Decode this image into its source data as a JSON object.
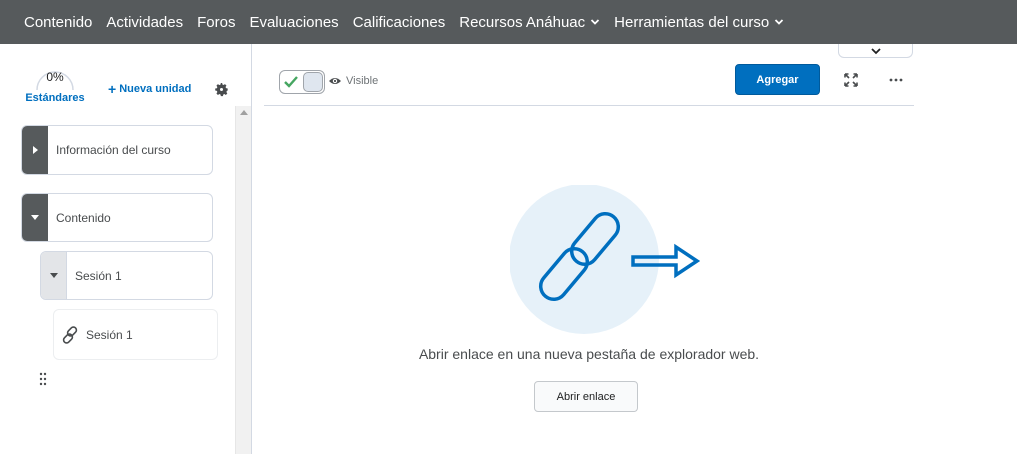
{
  "nav": {
    "items": [
      {
        "label": "Contenido"
      },
      {
        "label": "Actividades"
      },
      {
        "label": "Foros"
      },
      {
        "label": "Evaluaciones"
      },
      {
        "label": "Calificaciones"
      },
      {
        "label": "Recursos Anáhuac"
      },
      {
        "label": "Herramientas del curso"
      }
    ]
  },
  "sidebar": {
    "progress_value": "0%",
    "progress_label": "Estándares",
    "new_unit_label": "Nueva unidad",
    "tree": [
      {
        "label": "Información del curso"
      },
      {
        "label": "Contenido"
      },
      {
        "label": "Sesión 1"
      }
    ],
    "topic_label": "Sesión 1"
  },
  "toolbar": {
    "visibility_label": "Visible",
    "add_label": "Agregar"
  },
  "content": {
    "description": "Abrir enlace en una nueva pestaña de explorador web.",
    "open_link_label": "Abrir enlace"
  },
  "colors": {
    "nav_bg": "#565a5c",
    "primary": "#006fbf",
    "illustration_bg": "#e6f1f9"
  },
  "icons": [
    "chevron-down-icon",
    "gear-icon",
    "link-icon",
    "checkmark-icon",
    "eye-icon",
    "expand-icon",
    "more-icon",
    "drag-handle-icon"
  ]
}
